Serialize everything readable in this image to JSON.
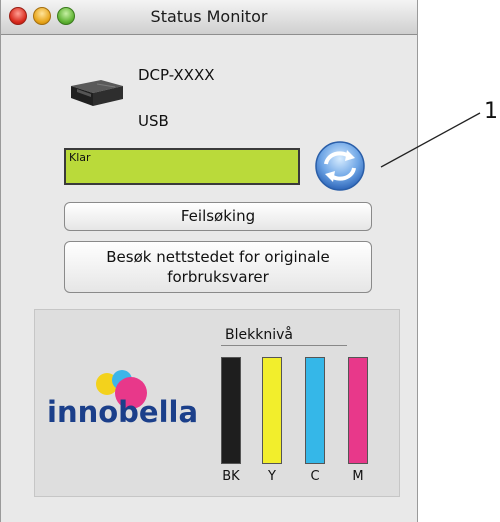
{
  "window": {
    "title": "Status Monitor"
  },
  "device": {
    "model": "DCP-XXXX",
    "connection": "USB",
    "icon": "printer-icon"
  },
  "status": {
    "text": "Klar",
    "color": "#bada3a",
    "refresh_icon": "refresh-icon"
  },
  "buttons": {
    "troubleshooting": "Feilsøking",
    "supplies_line1": "Besøk nettstedet for originale",
    "supplies_line2": "forbruksvarer"
  },
  "ink": {
    "title": "Blekknivå",
    "logo_text": "innobella",
    "cartridges": [
      {
        "label": "BK",
        "level": 1.0,
        "color": "#1e1e1e"
      },
      {
        "label": "Y",
        "level": 1.0,
        "color": "#f2ee2c"
      },
      {
        "label": "C",
        "level": 1.0,
        "color": "#35b7e8"
      },
      {
        "label": "M",
        "level": 1.0,
        "color": "#e8388a"
      }
    ]
  },
  "callout": {
    "number": "1"
  }
}
